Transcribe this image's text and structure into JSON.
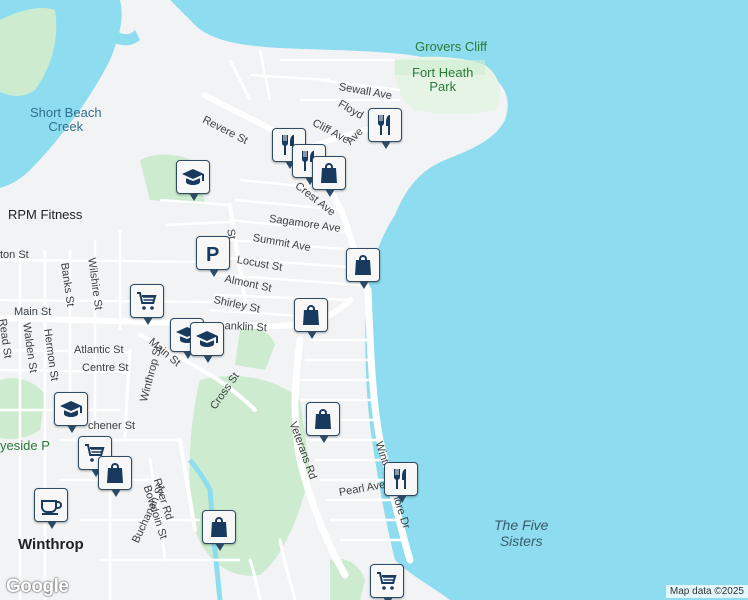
{
  "colors": {
    "water": "#8edcef",
    "land": "#f1f3f4",
    "park": "#cdeccf",
    "road": "#ffffff",
    "pin_border": "#2c4a66",
    "pin_icon": "#173a5e"
  },
  "labels": {
    "water": {
      "short_beach": "Short Beach\nCreek"
    },
    "park": {
      "grovers_cliff": "Grovers Cliff",
      "fort_heath": "Fort Heath\nPark",
      "yeside": "yeside P"
    },
    "poi": {
      "rpm_fitness": "RPM Fitness"
    },
    "city": {
      "winthrop": "Winthrop"
    },
    "sea": {
      "five_sisters": "The Five\nSisters"
    },
    "streets": {
      "revere": "Revere St",
      "sewall": "Sewall Ave",
      "floyd": "Floyd",
      "cliff": "Cliff Ave",
      "ave": "Ave",
      "crest": "Crest Ave",
      "sagamore": "Sagamore Ave",
      "summit": "Summit Ave",
      "locust": "Locust St",
      "almont": "Almont St",
      "shirley": "Shirley St",
      "anklin": "anklin St",
      "main_left": "Main St",
      "main_diag": "Main St",
      "atlantic": "Atlantic St",
      "centre": "Centre St",
      "cross": "Cross St",
      "veterans": "Veterans Rd",
      "pearl": "Pearl Ave",
      "winthrop_shore": "Winthrop Shore Dr",
      "river": "River Rd",
      "bowdoin": "Bowdoin St",
      "buchanan": "Buchanan St",
      "winthrop_st": "Winthrop St",
      "banks": "Banks St",
      "wilshire": "Wilshire St",
      "hermon": "Hermon St",
      "walden": "Walden St",
      "read": "Read St",
      "ton": "ton St",
      "chener": "chener St",
      "st_left": "St"
    }
  },
  "markers": [
    {
      "type": "restaurant",
      "name": "restaurant-fort-heath"
    },
    {
      "type": "restaurant",
      "name": "restaurant-crest-1"
    },
    {
      "type": "restaurant",
      "name": "restaurant-crest-2"
    },
    {
      "type": "shopping",
      "name": "shop-crest"
    },
    {
      "type": "school",
      "name": "school-north"
    },
    {
      "type": "parking",
      "name": "parking-center"
    },
    {
      "type": "shopping",
      "name": "shop-locust"
    },
    {
      "type": "shopping",
      "name": "shop-shirley"
    },
    {
      "type": "grocery",
      "name": "grocery-center"
    },
    {
      "type": "school",
      "name": "school-main-1"
    },
    {
      "type": "school",
      "name": "school-main-2"
    },
    {
      "type": "shopping",
      "name": "shop-veterans"
    },
    {
      "type": "restaurant",
      "name": "restaurant-pearl"
    },
    {
      "type": "school",
      "name": "school-west"
    },
    {
      "type": "grocery",
      "name": "grocery-west"
    },
    {
      "type": "shopping",
      "name": "shop-west"
    },
    {
      "type": "cafe",
      "name": "cafe-winthrop"
    },
    {
      "type": "shopping",
      "name": "shop-south"
    },
    {
      "type": "grocery",
      "name": "grocery-south"
    }
  ],
  "brand": "Google",
  "attribution": "Map data ©2025"
}
